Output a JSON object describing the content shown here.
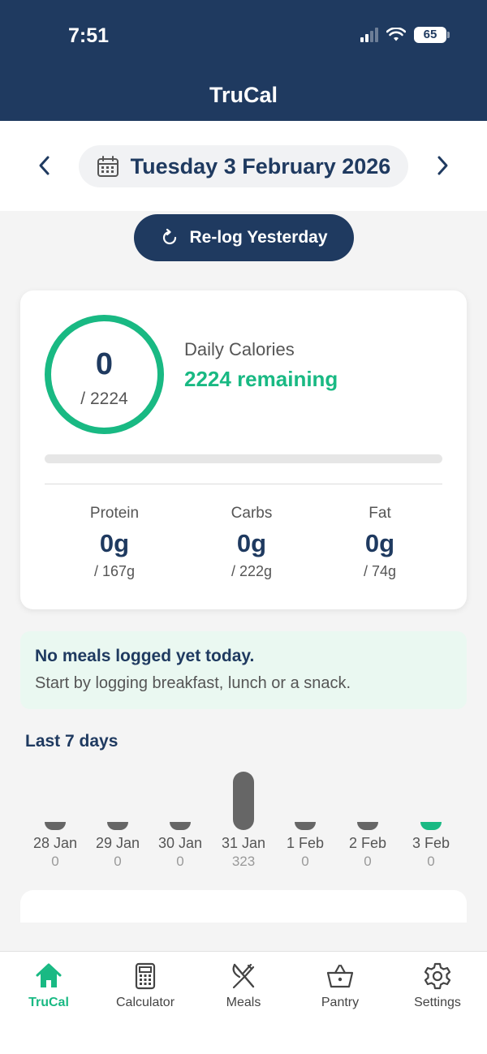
{
  "status": {
    "time": "7:51",
    "battery": "65"
  },
  "header": {
    "title": "TruCal"
  },
  "datebar": {
    "date": "Tuesday 3 February 2026"
  },
  "relog": {
    "label": "Re-log Yesterday"
  },
  "summary": {
    "consumed": "0",
    "target": "/ 2224",
    "label": "Daily Calories",
    "remaining": "2224 remaining",
    "progress": 0,
    "macros": [
      {
        "label": "Protein",
        "value": "0g",
        "target": "/ 167g"
      },
      {
        "label": "Carbs",
        "value": "0g",
        "target": "/ 222g"
      },
      {
        "label": "Fat",
        "value": "0g",
        "target": "/ 74g"
      }
    ]
  },
  "notice": {
    "title": "No meals logged yet today.",
    "body": "Start by logging breakfast, lunch or a snack."
  },
  "week": {
    "title": "Last 7 days",
    "days": [
      {
        "label": "28 Jan",
        "value": "0"
      },
      {
        "label": "29 Jan",
        "value": "0"
      },
      {
        "label": "30 Jan",
        "value": "0"
      },
      {
        "label": "31 Jan",
        "value": "323"
      },
      {
        "label": "1 Feb",
        "value": "0"
      },
      {
        "label": "2 Feb",
        "value": "0"
      },
      {
        "label": "3 Feb",
        "value": "0"
      }
    ]
  },
  "tabs": [
    {
      "label": "TruCal",
      "icon": "home-icon",
      "active": true
    },
    {
      "label": "Calculator",
      "icon": "calculator-icon"
    },
    {
      "label": "Meals",
      "icon": "fork-knife-icon"
    },
    {
      "label": "Pantry",
      "icon": "basket-icon"
    },
    {
      "label": "Settings",
      "icon": "gear-icon"
    }
  ],
  "colors": {
    "navy": "#1f3a60",
    "green": "#19b983"
  }
}
